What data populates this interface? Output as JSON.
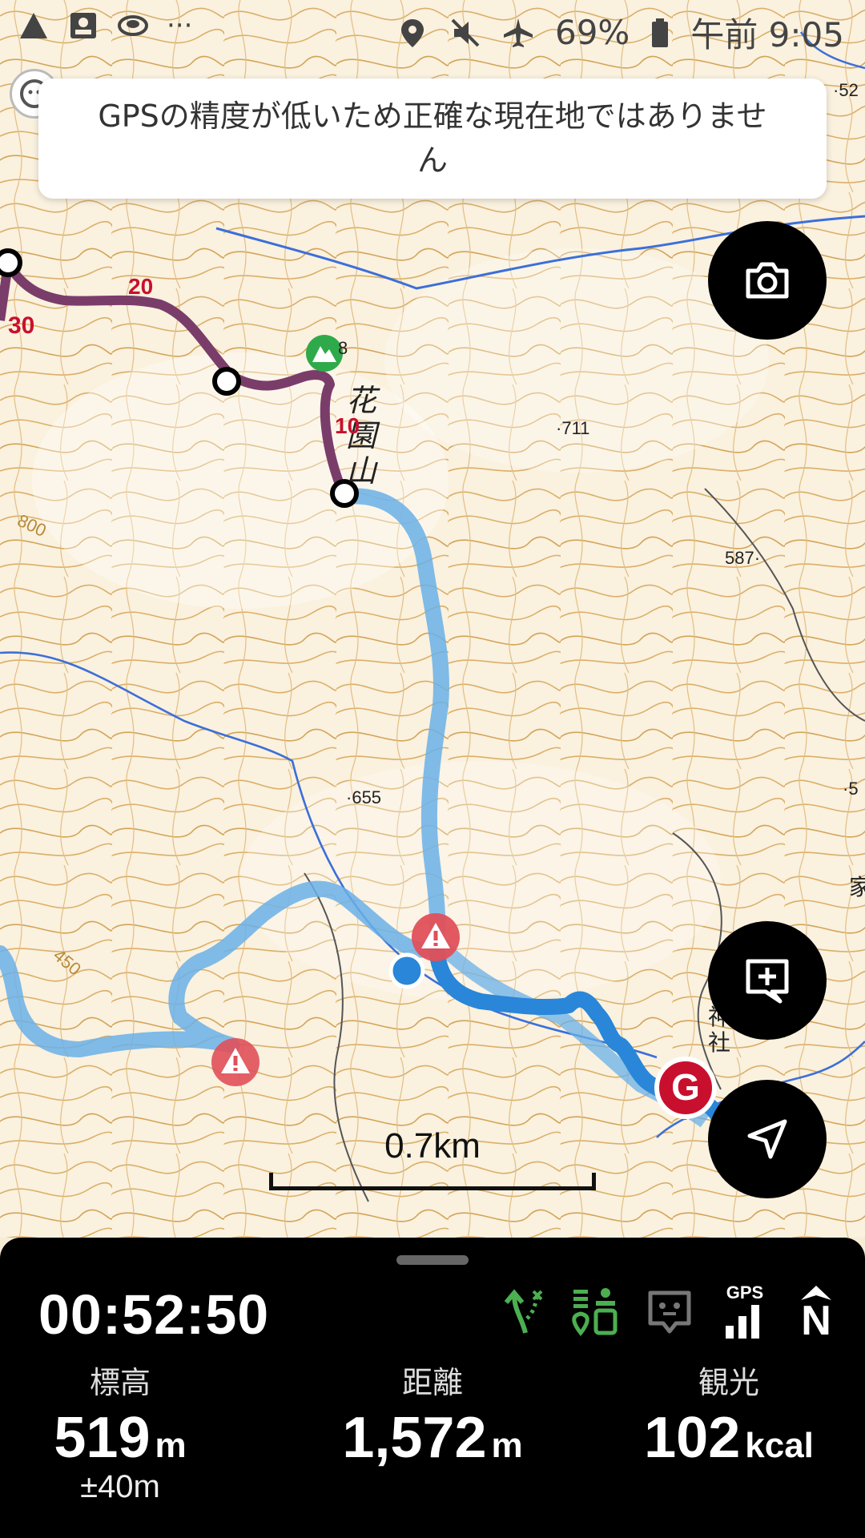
{
  "status_bar": {
    "battery_percent": "69%",
    "clock": "午前 9:05",
    "icons": [
      "warning-icon",
      "contact-card-icon",
      "sync-icon",
      "more-dots-icon",
      "location-pin-icon",
      "mute-icon",
      "airplane-icon",
      "battery-icon"
    ]
  },
  "toast": {
    "message": "GPSの精度が低いため正確な現在地ではありません"
  },
  "map": {
    "elevation_labels": [
      "711",
      "587",
      "655",
      "52",
      "5"
    ],
    "summit_label": "8",
    "mountain_name": "花園山",
    "place_labels": [
      "家",
      "神社"
    ],
    "distance_markers": [
      "30",
      "20",
      "10"
    ],
    "contour_labels": [
      "800",
      "450"
    ],
    "goal_marker": "G",
    "scale_label": "0.7km"
  },
  "buttons": {
    "camera": "camera-icon",
    "add_memo": "add-memo-icon",
    "navigate": "navigate-icon"
  },
  "panel": {
    "elapsed_time": "00:52:50",
    "gps_label": "GPS",
    "compass_label": "N",
    "stats": {
      "elevation": {
        "label": "標高",
        "value": "519",
        "unit": "m",
        "accuracy": "±40m"
      },
      "distance": {
        "label": "距離",
        "value": "1,572",
        "unit": "m"
      },
      "calories": {
        "label": "観光",
        "value": "102",
        "unit": "kcal"
      }
    }
  },
  "colors": {
    "route_past": "#7a3d6a",
    "route_plan": "#6ab0e8",
    "route_current": "#2a86d8",
    "hazard": "#e0505a",
    "goal": "#c8102e",
    "accent_green": "#4caf50"
  }
}
